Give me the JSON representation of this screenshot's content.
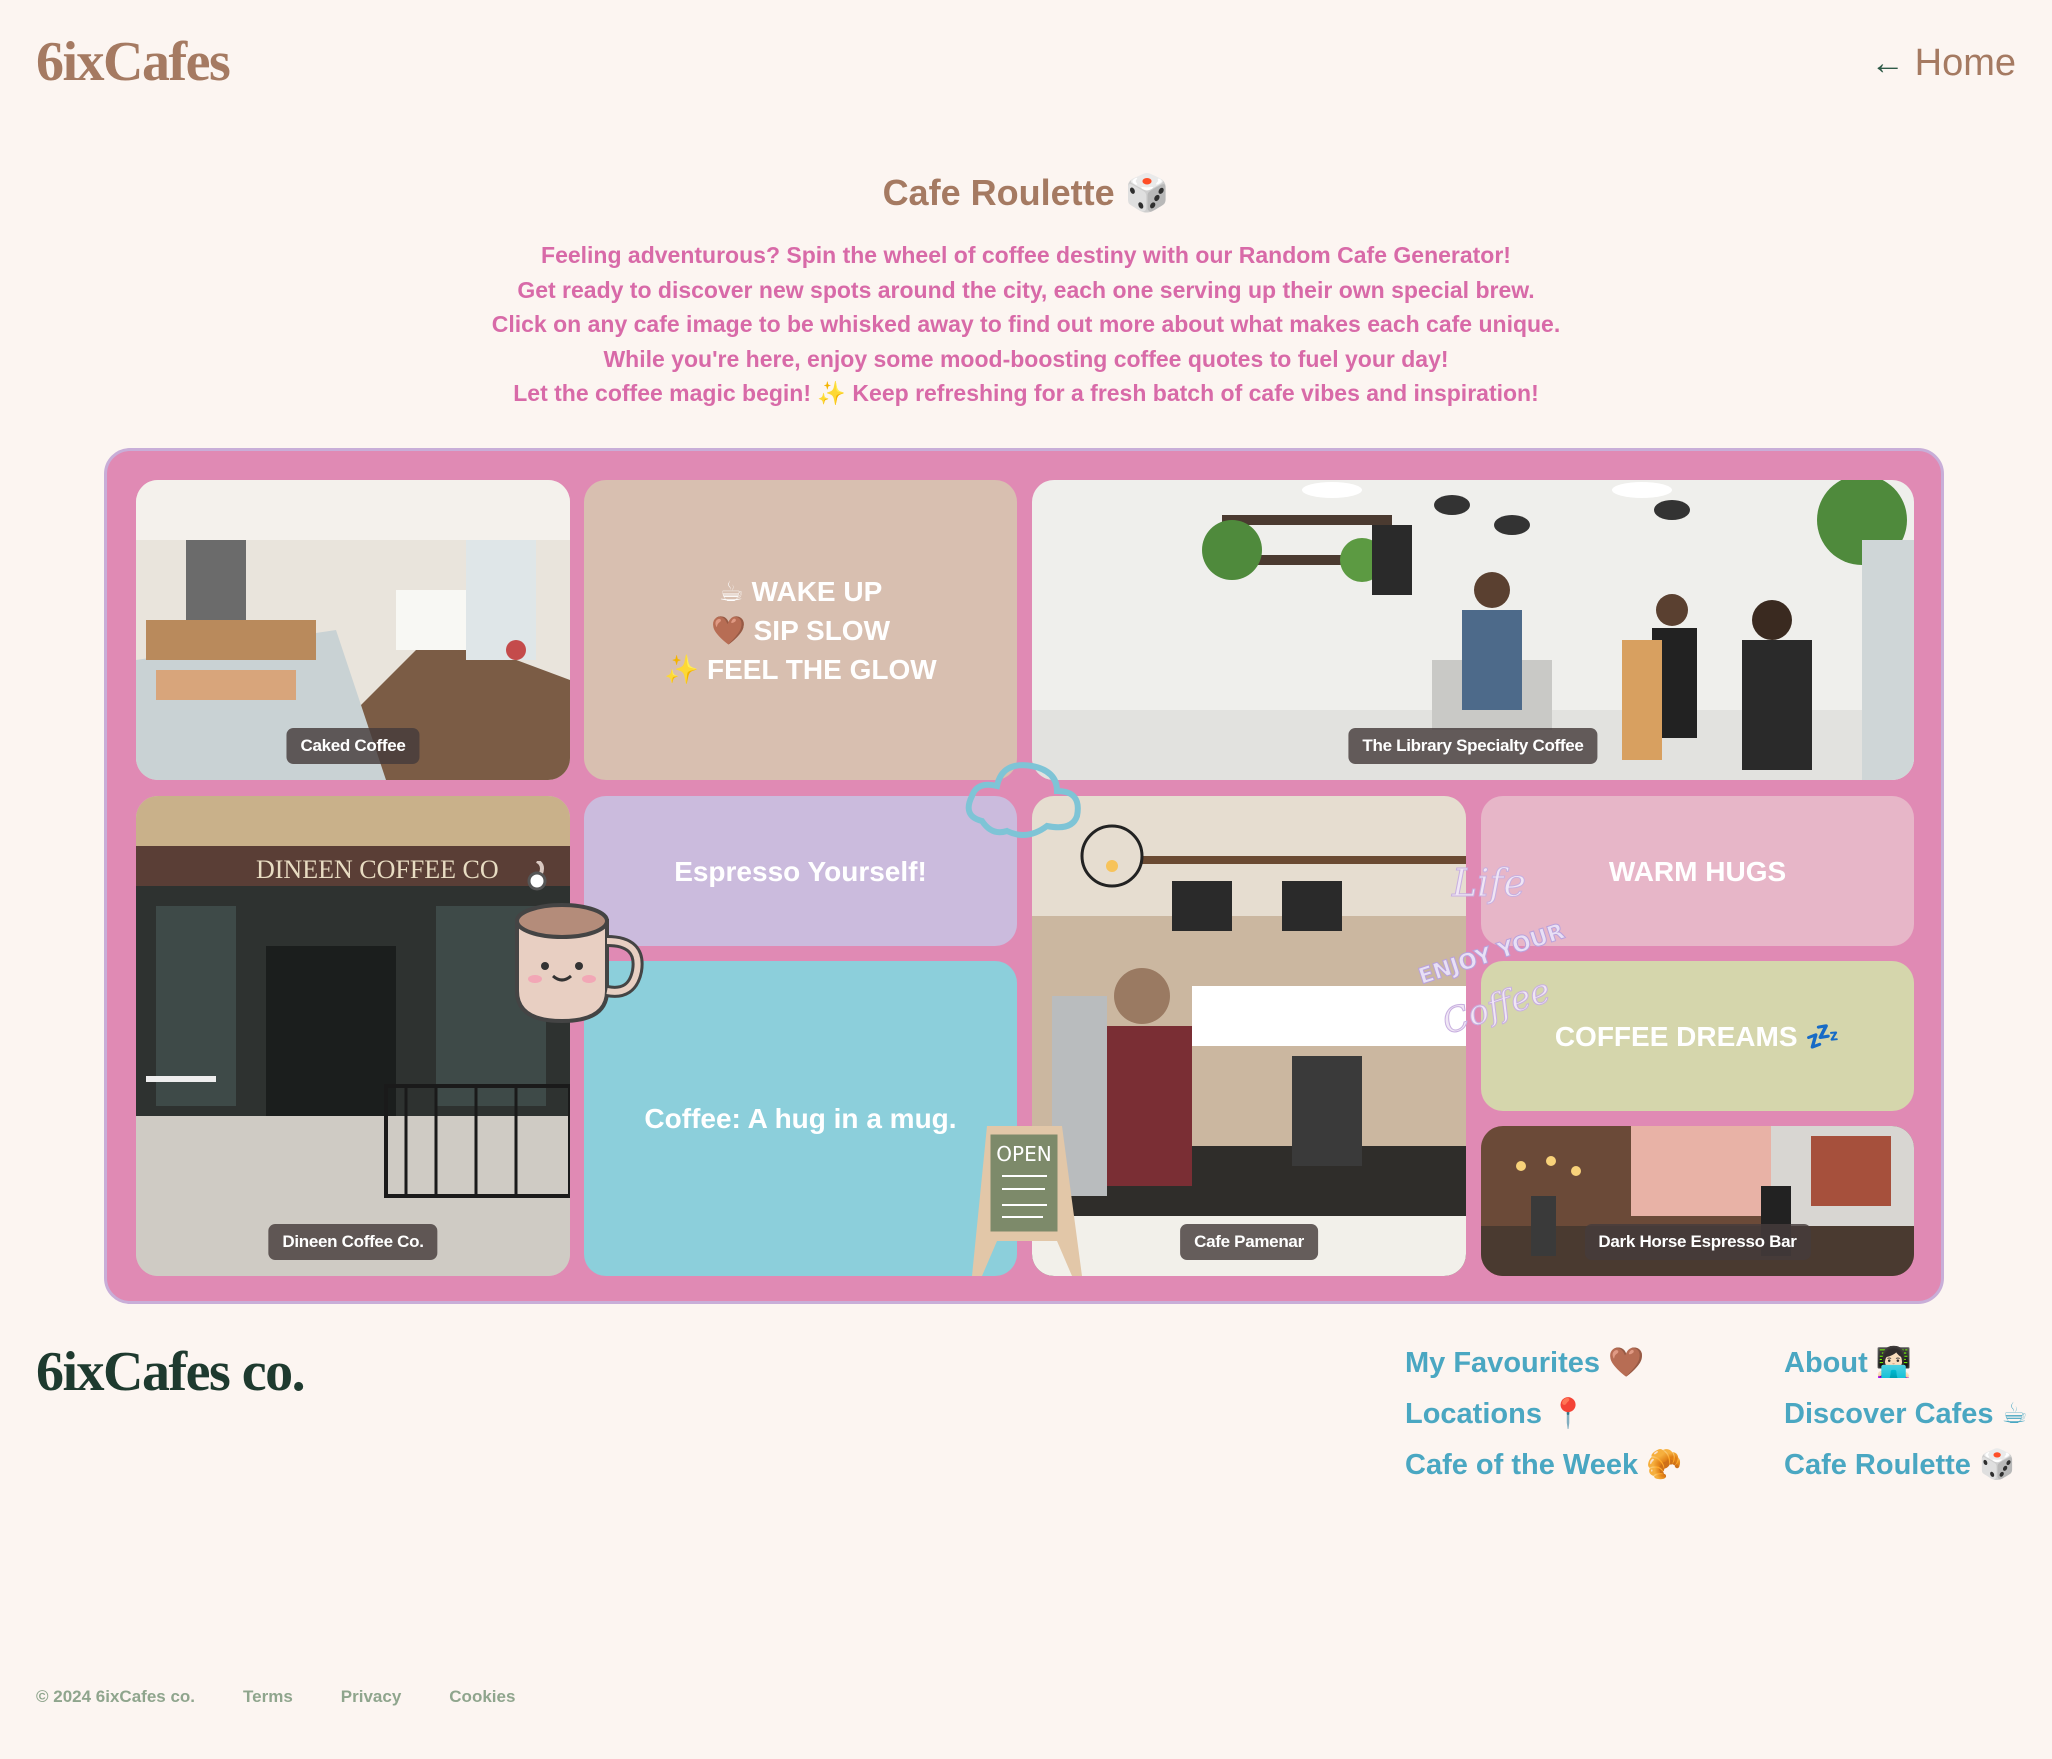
{
  "header": {
    "brand": "6ixCafes",
    "home_arrow": "←",
    "home_label": "Home"
  },
  "page": {
    "title": "Cafe Roulette 🎲",
    "intro": [
      "Feeling adventurous? Spin the wheel of coffee destiny with our Random Cafe Generator!",
      "Get ready to discover new spots around the city, each one serving up their own special brew.",
      "Click on any cafe image to be whisked away to find out more about what makes each cafe unique.",
      "While you're here, enjoy some mood-boosting coffee quotes to fuel your day!",
      "Let the coffee magic begin! ✨ Keep refreshing for a fresh batch of cafe vibes and inspiration!"
    ]
  },
  "grid": {
    "cafes": [
      {
        "name": "Caked Coffee"
      },
      {
        "name": "The Library Specialty Coffee"
      },
      {
        "name": "Dineen Coffee Co."
      },
      {
        "name": "Cafe Pamenar"
      },
      {
        "name": "Dark Horse Espresso Bar"
      }
    ],
    "quotes": {
      "wake_up": [
        "☕ WAKE UP",
        "🤎 SIP SLOW",
        "✨ FEEL THE GLOW"
      ],
      "espresso": "Espresso Yourself!",
      "hug": "Coffee: A hug in a mug.",
      "warm_hugs": "WARM HUGS",
      "dreams": "COFFEE DREAMS 💤"
    },
    "sign_text": "OPEN",
    "neon_text": [
      "Life",
      "ENJOY YOUR",
      "Coffee"
    ],
    "dineen_sign": "DINEEN COFFEE CO",
    "colors": {
      "board": "#e08ab4",
      "wake": "#d8bfb0",
      "espresso": "#cbbbdd",
      "hug": "#8ccfdb",
      "warm": "#e7b6c8",
      "dreams": "#d5d6ac"
    }
  },
  "footer": {
    "brand": "6ixCafes co.",
    "col1": [
      "My Favourites 🤎",
      "Locations 📍",
      "Cafe of the Week 🥐"
    ],
    "col2": [
      "About 👩🏻‍💻",
      "Discover Cafes ☕",
      "Cafe Roulette 🎲"
    ],
    "copyright": "© 2024 6ixCafes co.",
    "legal": [
      "Terms",
      "Privacy",
      "Cookies"
    ]
  }
}
